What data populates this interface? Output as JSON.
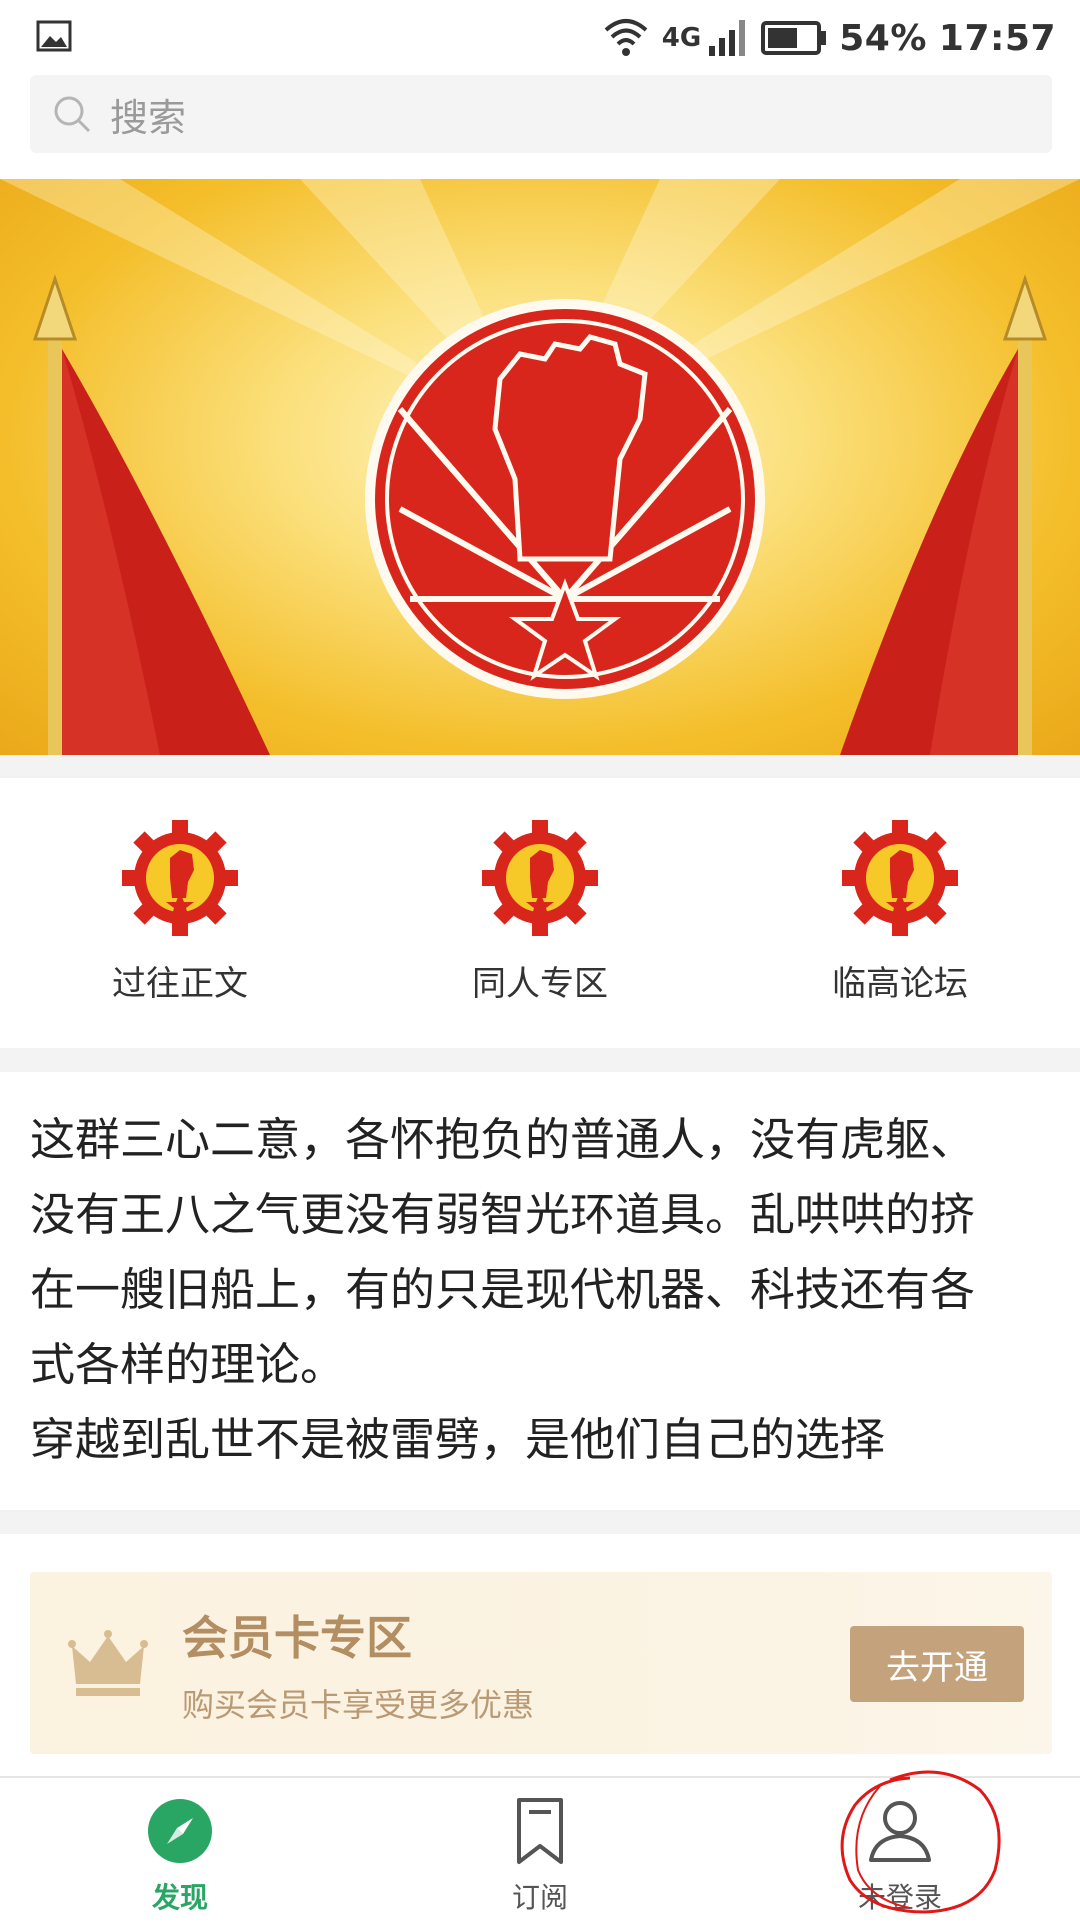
{
  "status_bar": {
    "network": "4G",
    "battery_percent": "54%",
    "time": "17:57"
  },
  "search": {
    "placeholder": "搜索"
  },
  "categories": [
    {
      "label": "过往正文",
      "icon": "gear-emblem-icon"
    },
    {
      "label": "同人专区",
      "icon": "gear-emblem-icon"
    },
    {
      "label": "临高论坛",
      "icon": "gear-emblem-icon"
    }
  ],
  "description": {
    "lines": [
      "这群三心二意，各怀抱负的普通人，没有虎躯、",
      "没有王八之气更没有弱智光环道具。乱哄哄的挤",
      "在一艘旧船上，有的只是现代机器、科技还有各",
      "式各样的理论。",
      "穿越到乱世不是被雷劈，是他们自己的选择"
    ]
  },
  "membership": {
    "title": "会员卡专区",
    "subtitle": "购买会员卡享受更多优惠",
    "button_label": "去开通"
  },
  "bottom_nav": {
    "items": [
      {
        "label": "发现",
        "icon": "compass-icon",
        "active": true
      },
      {
        "label": "订阅",
        "icon": "bookmark-icon",
        "active": false
      },
      {
        "label": "未登录",
        "icon": "user-icon",
        "active": false
      }
    ]
  },
  "colors": {
    "accent_green": "#2aa664",
    "member_gold": "#c4a37c",
    "banner_red": "#d9261c"
  }
}
